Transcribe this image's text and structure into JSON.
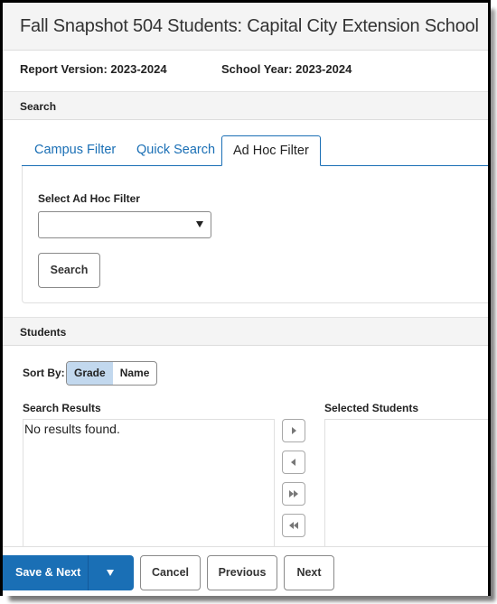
{
  "header": {
    "title": "Fall Snapshot 504 Students: Capital City Extension School",
    "report_version": "Report Version: 2023-2024",
    "school_year": "School Year: 2023-2024"
  },
  "search_section": {
    "title": "Search",
    "tabs": [
      {
        "label": "Campus Filter",
        "active": false
      },
      {
        "label": "Quick Search",
        "active": false
      },
      {
        "label": "Ad Hoc Filter",
        "active": true
      }
    ],
    "filter_label": "Select Ad Hoc Filter",
    "filter_value": "",
    "search_button": "Search"
  },
  "students_section": {
    "title": "Students",
    "sort_label": "Sort By:",
    "sort_options": [
      {
        "label": "Grade",
        "active": true
      },
      {
        "label": "Name",
        "active": false
      }
    ],
    "search_results_label": "Search Results",
    "search_results_empty": "No results found.",
    "selected_students_label": "Selected Students",
    "move_buttons": [
      "move-right",
      "move-left",
      "move-all-right",
      "move-all-left"
    ]
  },
  "footer": {
    "save_next": "Save & Next",
    "cancel": "Cancel",
    "previous": "Previous",
    "next": "Next"
  },
  "colors": {
    "accent": "#1a6fb5",
    "sort_active": "#c2d8ee",
    "section_bg": "#f4f4f4"
  }
}
